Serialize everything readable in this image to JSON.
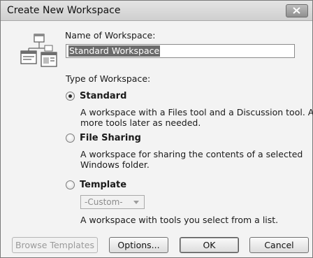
{
  "window": {
    "title": "Create New Workspace",
    "close_icon": "close-icon"
  },
  "form": {
    "name_label": "Name of Workspace:",
    "name_value": "Standard Workspace",
    "type_label": "Type of Workspace:"
  },
  "options": [
    {
      "label": "Standard",
      "checked": true,
      "description_line1": "A workspace with a Files tool and a Discussion tool.  Add",
      "description_line2": "more tools later as needed."
    },
    {
      "label": "File Sharing",
      "checked": false,
      "description_line1": "A workspace for sharing the contents of a selected",
      "description_line2": "Windows folder."
    },
    {
      "label": "Template",
      "checked": false,
      "select_value": "-Custom-",
      "description_line1": "A workspace with tools you select from a list."
    }
  ],
  "buttons": {
    "browse_templates": "Browse Templates",
    "options": "Options...",
    "ok": "OK",
    "cancel": "Cancel"
  }
}
